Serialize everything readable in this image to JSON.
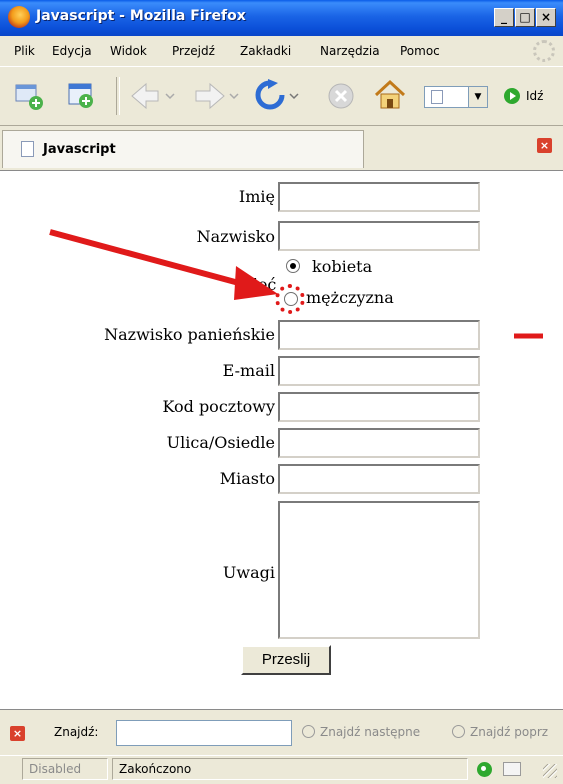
{
  "window": {
    "title": "Javascript - Mozilla Firefox"
  },
  "menu": [
    "Plik",
    "Edycja",
    "Widok",
    "Przejdź",
    "Zakładki",
    "Narzędzia",
    "Pomoc"
  ],
  "toolbar": {
    "go_label": "Idź"
  },
  "tab": {
    "label": "Javascript"
  },
  "form": {
    "first_name_label": "Imię",
    "last_name_label": "Nazwisko",
    "gender_label": "Płeć",
    "gender_options": [
      "kobieta",
      "mężczyzna"
    ],
    "gender_selected": "kobieta",
    "maiden_name_label": "Nazwisko panieńskie",
    "email_label": "E-mail",
    "postal_code_label": "Kod pocztowy",
    "street_label": "Ulica/Osiedle",
    "city_label": "Miasto",
    "notes_label": "Uwagi",
    "submit_label": "Przeslij"
  },
  "findbar": {
    "label": "Znajdź:",
    "next_label": "Znajdź następne",
    "prev_label": "Znajdź poprz"
  },
  "status": {
    "left": "Disabled",
    "text": "Zakończono"
  },
  "colors": {
    "annotation": "#e01a1a",
    "title_bar": "#0b4fd8"
  }
}
